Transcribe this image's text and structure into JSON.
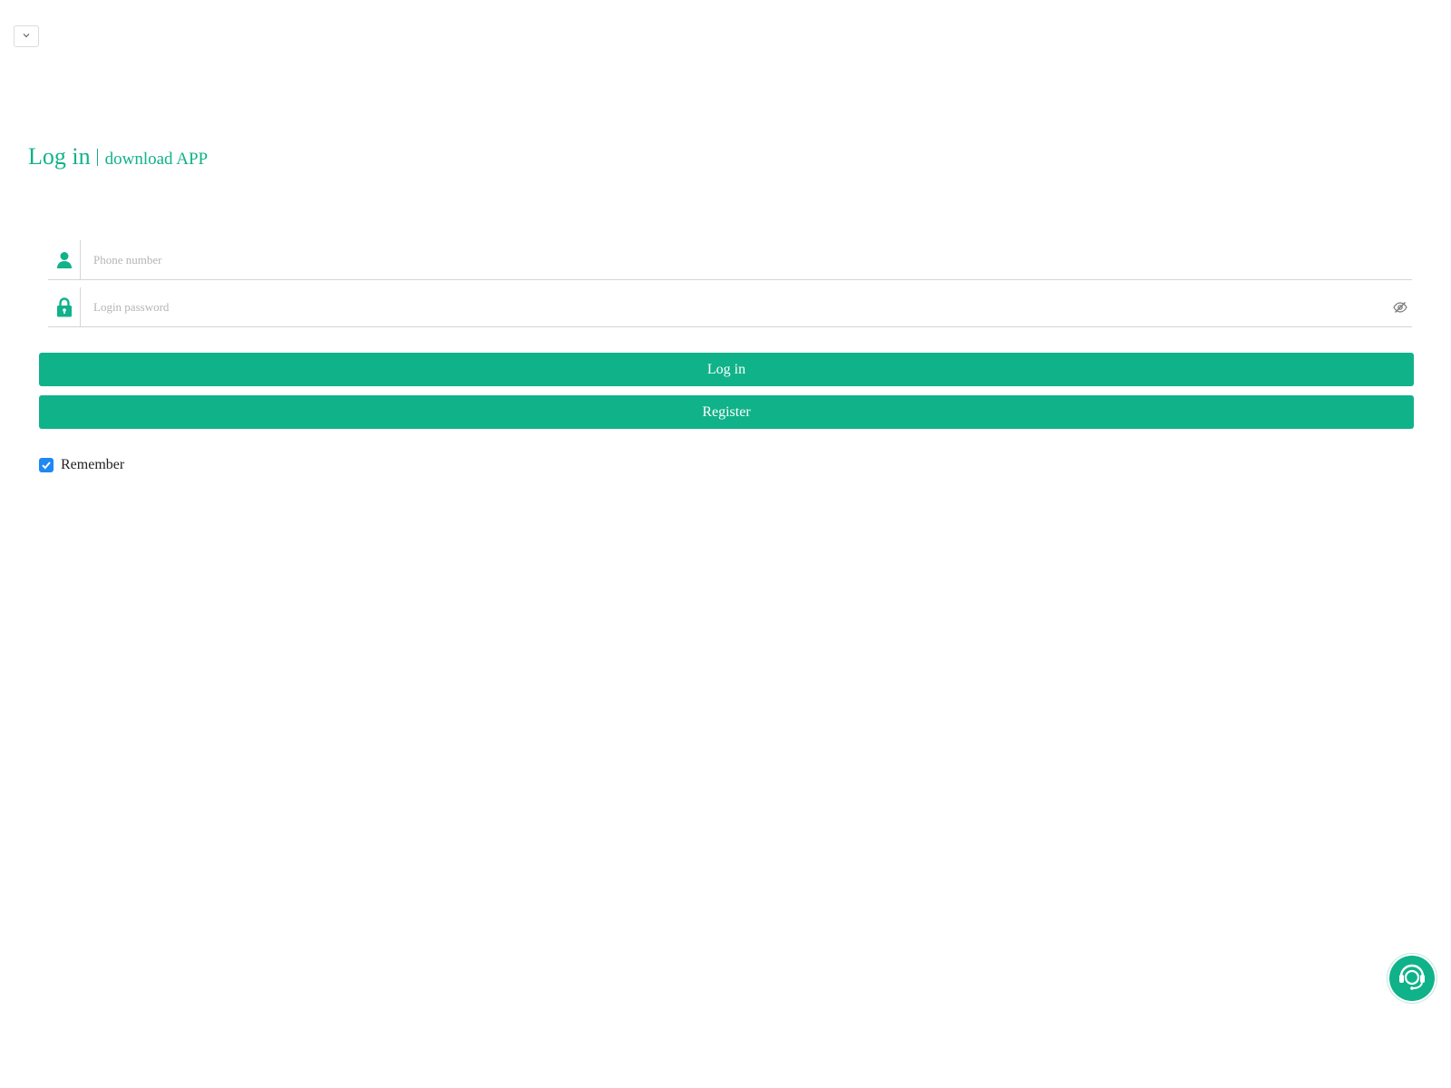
{
  "header": {
    "title": "Log in",
    "download_link": "download APP"
  },
  "form": {
    "phone": {
      "placeholder": "Phone number",
      "value": "",
      "icon": "user-icon"
    },
    "password": {
      "placeholder": "Login password",
      "value": "",
      "icon": "lock-icon",
      "toggle_icon": "eye-off-icon"
    },
    "login_label": "Log in",
    "register_label": "Register",
    "remember_label": "Remember",
    "remember_checked": true
  },
  "language_select": {
    "icon": "chevron-down-icon"
  },
  "support": {
    "icon": "customer-service-icon"
  },
  "colors": {
    "accent": "#10b289",
    "checkbox": "#1e88f5",
    "border": "#d5d5d5"
  }
}
